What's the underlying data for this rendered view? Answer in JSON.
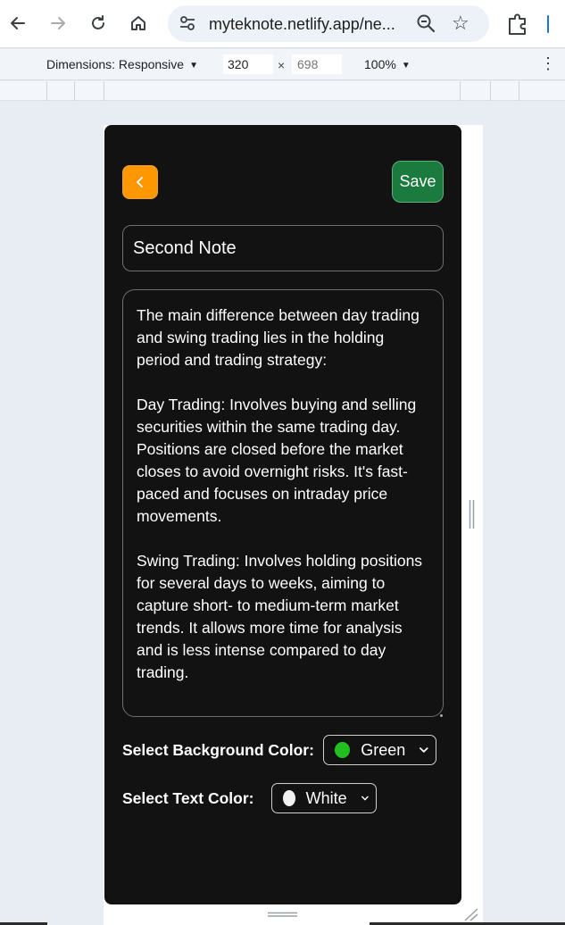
{
  "browser": {
    "url": "myteknote.netlify.app/ne...",
    "back_icon": "arrow-left-icon",
    "forward_icon": "arrow-right-icon",
    "reload_icon": "reload-icon",
    "home_icon": "home-icon",
    "zoom_icon": "zoom-icon",
    "bookmark_icon": "star-icon",
    "extensions_icon": "puzzle-icon"
  },
  "devtools": {
    "dimensions_label": "Dimensions: Responsive",
    "width": "320",
    "times": "×",
    "height_placeholder": "698",
    "zoom": "100%",
    "more_icon": "kebab-menu-icon"
  },
  "note": {
    "back_label": "‹",
    "save_label": "Save",
    "title_value": "Second Note",
    "body": "The main difference between day trading and swing trading lies in the holding period and trading strategy:\n\nDay Trading: Involves buying and selling securities within the same trading day. Positions are closed before the market closes to avoid overnight risks. It's fast-paced and focuses on intraday price movements.\n\nSwing Trading: Involves holding positions for several days to weeks, aiming to capture short- to medium-term market trends. It allows more time for analysis and is less intense compared to day trading.",
    "bg_label": "Select Background Color:",
    "bg_value": "Green",
    "bg_swatch": "#22c01e",
    "text_label": "Select Text Color:",
    "text_value": "White",
    "text_swatch": "#f2f2f2"
  },
  "colors": {
    "app_bg": "#121212",
    "back_button": "#ff9800",
    "save_button": "#1b7a3d"
  }
}
